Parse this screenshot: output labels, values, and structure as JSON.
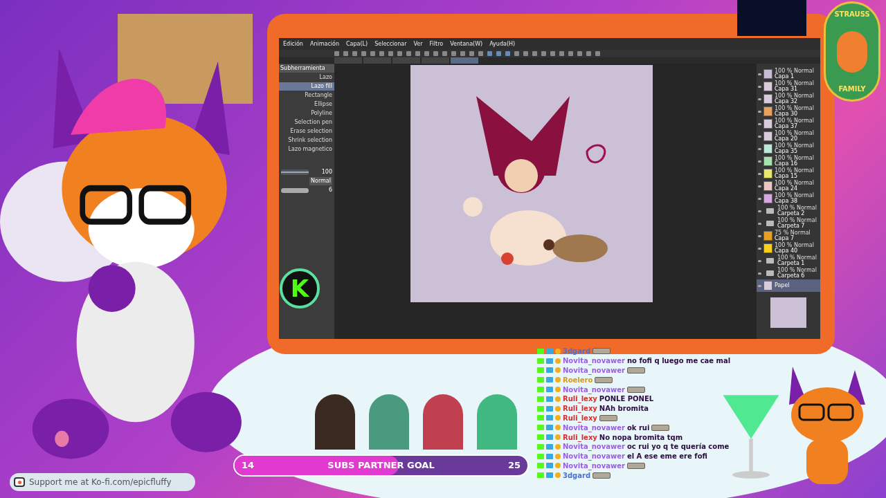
{
  "app": {
    "menu": [
      "Edición",
      "Animación",
      "Capa(L)",
      "Seleccionar",
      "Ver",
      "Filtro",
      "Ventana(W)",
      "Ayuda(H)"
    ],
    "tabs": [
      {
        "selected": false
      },
      {
        "selected": false
      },
      {
        "selected": false
      },
      {
        "selected": false
      },
      {
        "selected": true
      }
    ],
    "tool_panel": {
      "title": "Subherramienta",
      "tools": [
        {
          "label": "Lazo",
          "selected": false
        },
        {
          "label": "Lazo fill",
          "selected": true
        },
        {
          "label": "Rectangle",
          "selected": false
        },
        {
          "label": "Ellipse",
          "selected": false
        },
        {
          "label": "Polyline",
          "selected": false
        },
        {
          "label": "Selection pen",
          "selected": false
        },
        {
          "label": "Erase selection",
          "selected": false
        },
        {
          "label": "Shrink selection",
          "selected": false
        },
        {
          "label": "Lazo magnetico",
          "selected": false
        }
      ],
      "opacity": {
        "value": "100",
        "level": 1
      },
      "blend": "Normal",
      "stabilization": "6"
    },
    "layers": [
      {
        "name": "Capa 1",
        "mode": "100 % Normal",
        "kind": "layer",
        "color": "#c8bcd4",
        "selected": false
      },
      {
        "name": "Capa 31",
        "mode": "100 % Normal",
        "kind": "layer",
        "color": "#d8ccdc",
        "selected": false
      },
      {
        "name": "Capa 32",
        "mode": "100 % Normal",
        "kind": "layer",
        "color": "#d8ccdc",
        "selected": false
      },
      {
        "name": "Capa 30",
        "mode": "100 % Normal",
        "kind": "layer",
        "color": "#e8a060",
        "selected": false
      },
      {
        "name": "Capa 37",
        "mode": "100 % Normal",
        "kind": "layer",
        "color": "#d8ccdc",
        "selected": false
      },
      {
        "name": "Capa 20",
        "mode": "100 % Normal",
        "kind": "layer",
        "color": "#d8ccdc",
        "selected": false
      },
      {
        "name": "Capa 35",
        "mode": "100 % Normal",
        "kind": "layer",
        "color": "#bfe8dc",
        "selected": false
      },
      {
        "name": "Capa 16",
        "mode": "100 % Normal",
        "kind": "layer",
        "color": "#a8e0b0",
        "selected": false
      },
      {
        "name": "Capa 15",
        "mode": "100 % Normal",
        "kind": "layer",
        "color": "#e8e870",
        "selected": false
      },
      {
        "name": "Capa 24",
        "mode": "100 % Normal",
        "kind": "layer",
        "color": "#e8c8c0",
        "selected": false
      },
      {
        "name": "Capa 38",
        "mode": "100 % Normal",
        "kind": "layer",
        "color": "#d8a8e0",
        "selected": false
      },
      {
        "name": "Carpeta 2",
        "mode": "100 % Normal",
        "kind": "folder",
        "selected": false
      },
      {
        "name": "Carpeta 7",
        "mode": "100 % Normal",
        "kind": "folder",
        "selected": false
      },
      {
        "name": "Capa 7",
        "mode": "75 % Normal",
        "kind": "layer",
        "color": "#e8a020",
        "selected": false
      },
      {
        "name": "Capa 40",
        "mode": "100 % Normal",
        "kind": "layer",
        "color": "#f8d020",
        "selected": false
      },
      {
        "name": "Carpeta 1",
        "mode": "100 % Normal",
        "kind": "folder",
        "selected": false
      },
      {
        "name": "Carpeta 6",
        "mode": "100 % Normal",
        "kind": "folder",
        "selected": false
      },
      {
        "name": "Papel",
        "kind": "paper",
        "color": "#d6ccdc",
        "selected": true
      }
    ]
  },
  "kick_logo": "K",
  "badge": {
    "top": "STRAUSS",
    "bottom": "FAMILY"
  },
  "chat": [
    {
      "user": "3dgard",
      "color": "#4a6fd0",
      "emote": true
    },
    {
      "user": "Novita_novawer",
      "color": "#9b5de5",
      "text": "no fofi q luego me cae mal"
    },
    {
      "user": "Novita_novawer",
      "color": "#9b5de5",
      "emote": true
    },
    {
      "user": "Roelero",
      "color": "#d99a1a",
      "emote": true
    },
    {
      "user": "Novita_novawer",
      "color": "#9b5de5",
      "emote": true
    },
    {
      "user": "Ruli_lexy",
      "color": "#d03030",
      "text": "PONLE PONEL"
    },
    {
      "user": "Ruli_lexy",
      "color": "#d03030",
      "text": "NAh bromita"
    },
    {
      "user": "Ruli_lexy",
      "color": "#d03030",
      "emote": true
    },
    {
      "user": "Novita_novawer",
      "color": "#9b5de5",
      "text": "ok rui",
      "emote": true
    },
    {
      "user": "Ruli_lexy",
      "color": "#d03030",
      "text": "No nopa bromita tqm"
    },
    {
      "user": "Novita_novawer",
      "color": "#9b5de5",
      "text": "oc rui yo q te quería come"
    },
    {
      "user": "Novita_novawer",
      "color": "#9b5de5",
      "text": "el A ese eme ere fofi"
    },
    {
      "user": "Novita_novawer",
      "color": "#9b5de5",
      "emote": true
    },
    {
      "user": "3dgard",
      "color": "#4a6fd0",
      "emote": true
    }
  ],
  "goal": {
    "current": "14",
    "title": "SUBS PARTNER GOAL",
    "target": "25",
    "level": 0.56
  },
  "kofi": {
    "text": "Support me at Ko-fi.com/epicfluffy"
  }
}
